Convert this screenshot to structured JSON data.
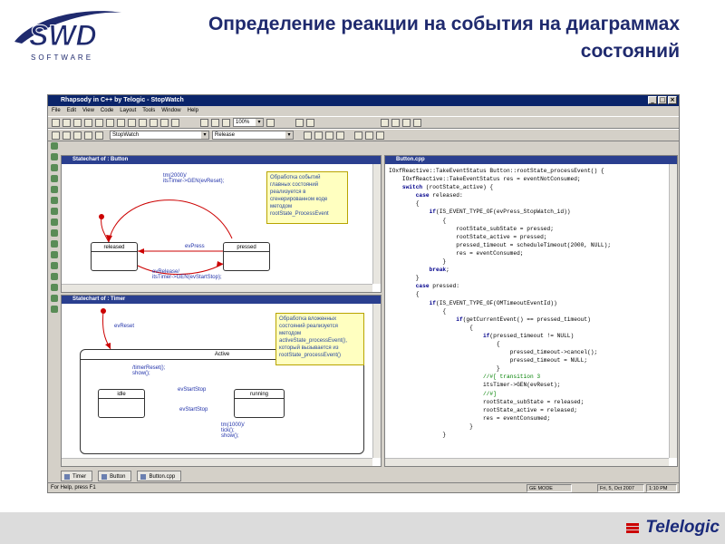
{
  "slide": {
    "title": "Определение реакции на события на диаграммах состояний",
    "logo_text": "SWD",
    "logo_sub": "SOFTWARE",
    "footer_brand": "Telelogic"
  },
  "window": {
    "title": "Rhapsody in C++ by Telogic - StopWatch",
    "menu": [
      "File",
      "Edit",
      "View",
      "Code",
      "Layout",
      "Tools",
      "Window",
      "Help"
    ],
    "zoom": "100%",
    "project_combo": "StopWatch",
    "config_combo": "Release"
  },
  "pane_button": {
    "title": "Statechart of : Button",
    "note": [
      "Обработка событий",
      "главных состояний",
      "реализуется в",
      "сгенерированном коде",
      "методом",
      "rootState_ProcessEvent"
    ],
    "state_released": "released",
    "state_pressed": "pressed",
    "trans_top": [
      "tm(2000)/",
      "itsTimer->GEN(evReset);"
    ],
    "trans_press": "evPress",
    "trans_release": [
      "evRelease/",
      "itsTimer->GEN(evStartStop);"
    ]
  },
  "pane_timer": {
    "title": "Statechart of : Timer",
    "note": [
      "Обработка вложенных",
      "состояний реализуется",
      "методом",
      "activeState_processEvent(),",
      "который вызывается из",
      "rootState_processEvent()"
    ],
    "trans_reset": "evReset",
    "state_active": "Active",
    "state_idle": "idle",
    "state_running": "running",
    "trans_init": [
      "/timerReset();",
      "show();"
    ],
    "trans_start1": "evStartStop",
    "trans_start2": "evStartStop",
    "trans_tm": [
      "tm(1000)/",
      "tick();",
      "show();"
    ]
  },
  "pane_code": {
    "title": "Button.cpp",
    "lines": [
      "IOxfReactive::TakeEventStatus Button::rootState_processEvent() {",
      "    IOxfReactive::TakeEventStatus res = eventNotConsumed;",
      "    switch (rootState_active) {",
      "        case released:",
      "        {",
      "            if(IS_EVENT_TYPE_OF(evPress_StopWatch_id))",
      "                {",
      "                    rootState_subState = pressed;",
      "                    rootState_active = pressed;",
      "                    pressed_timeout = scheduleTimeout(2000, NULL);",
      "                    res = eventConsumed;",
      "                }",
      "",
      "            break;",
      "        }",
      "        case pressed:",
      "        {",
      "            if(IS_EVENT_TYPE_OF(OMTimeoutEventId))",
      "                {",
      "                    if(getCurrentEvent() == pressed_timeout)",
      "                        {",
      "                            if(pressed_timeout != NULL)",
      "                                {",
      "                                    pressed_timeout->cancel();",
      "                                    pressed_timeout = NULL;",
      "                                }",
      "                            //#[ transition 3",
      "",
      "                            itsTimer->GEN(evReset);",
      "                            //#]",
      "                            rootState_subState = released;",
      "                            rootState_active = released;",
      "                            res = eventConsumed;",
      "                        }",
      "                }"
    ]
  },
  "tabs": [
    "Timer",
    "Button",
    "Button.cpp"
  ],
  "status": {
    "help": "For Help, press F1",
    "mode": "GE MODE",
    "date": "Fri, 5, Oct 2007",
    "time": "1:10 PM"
  }
}
